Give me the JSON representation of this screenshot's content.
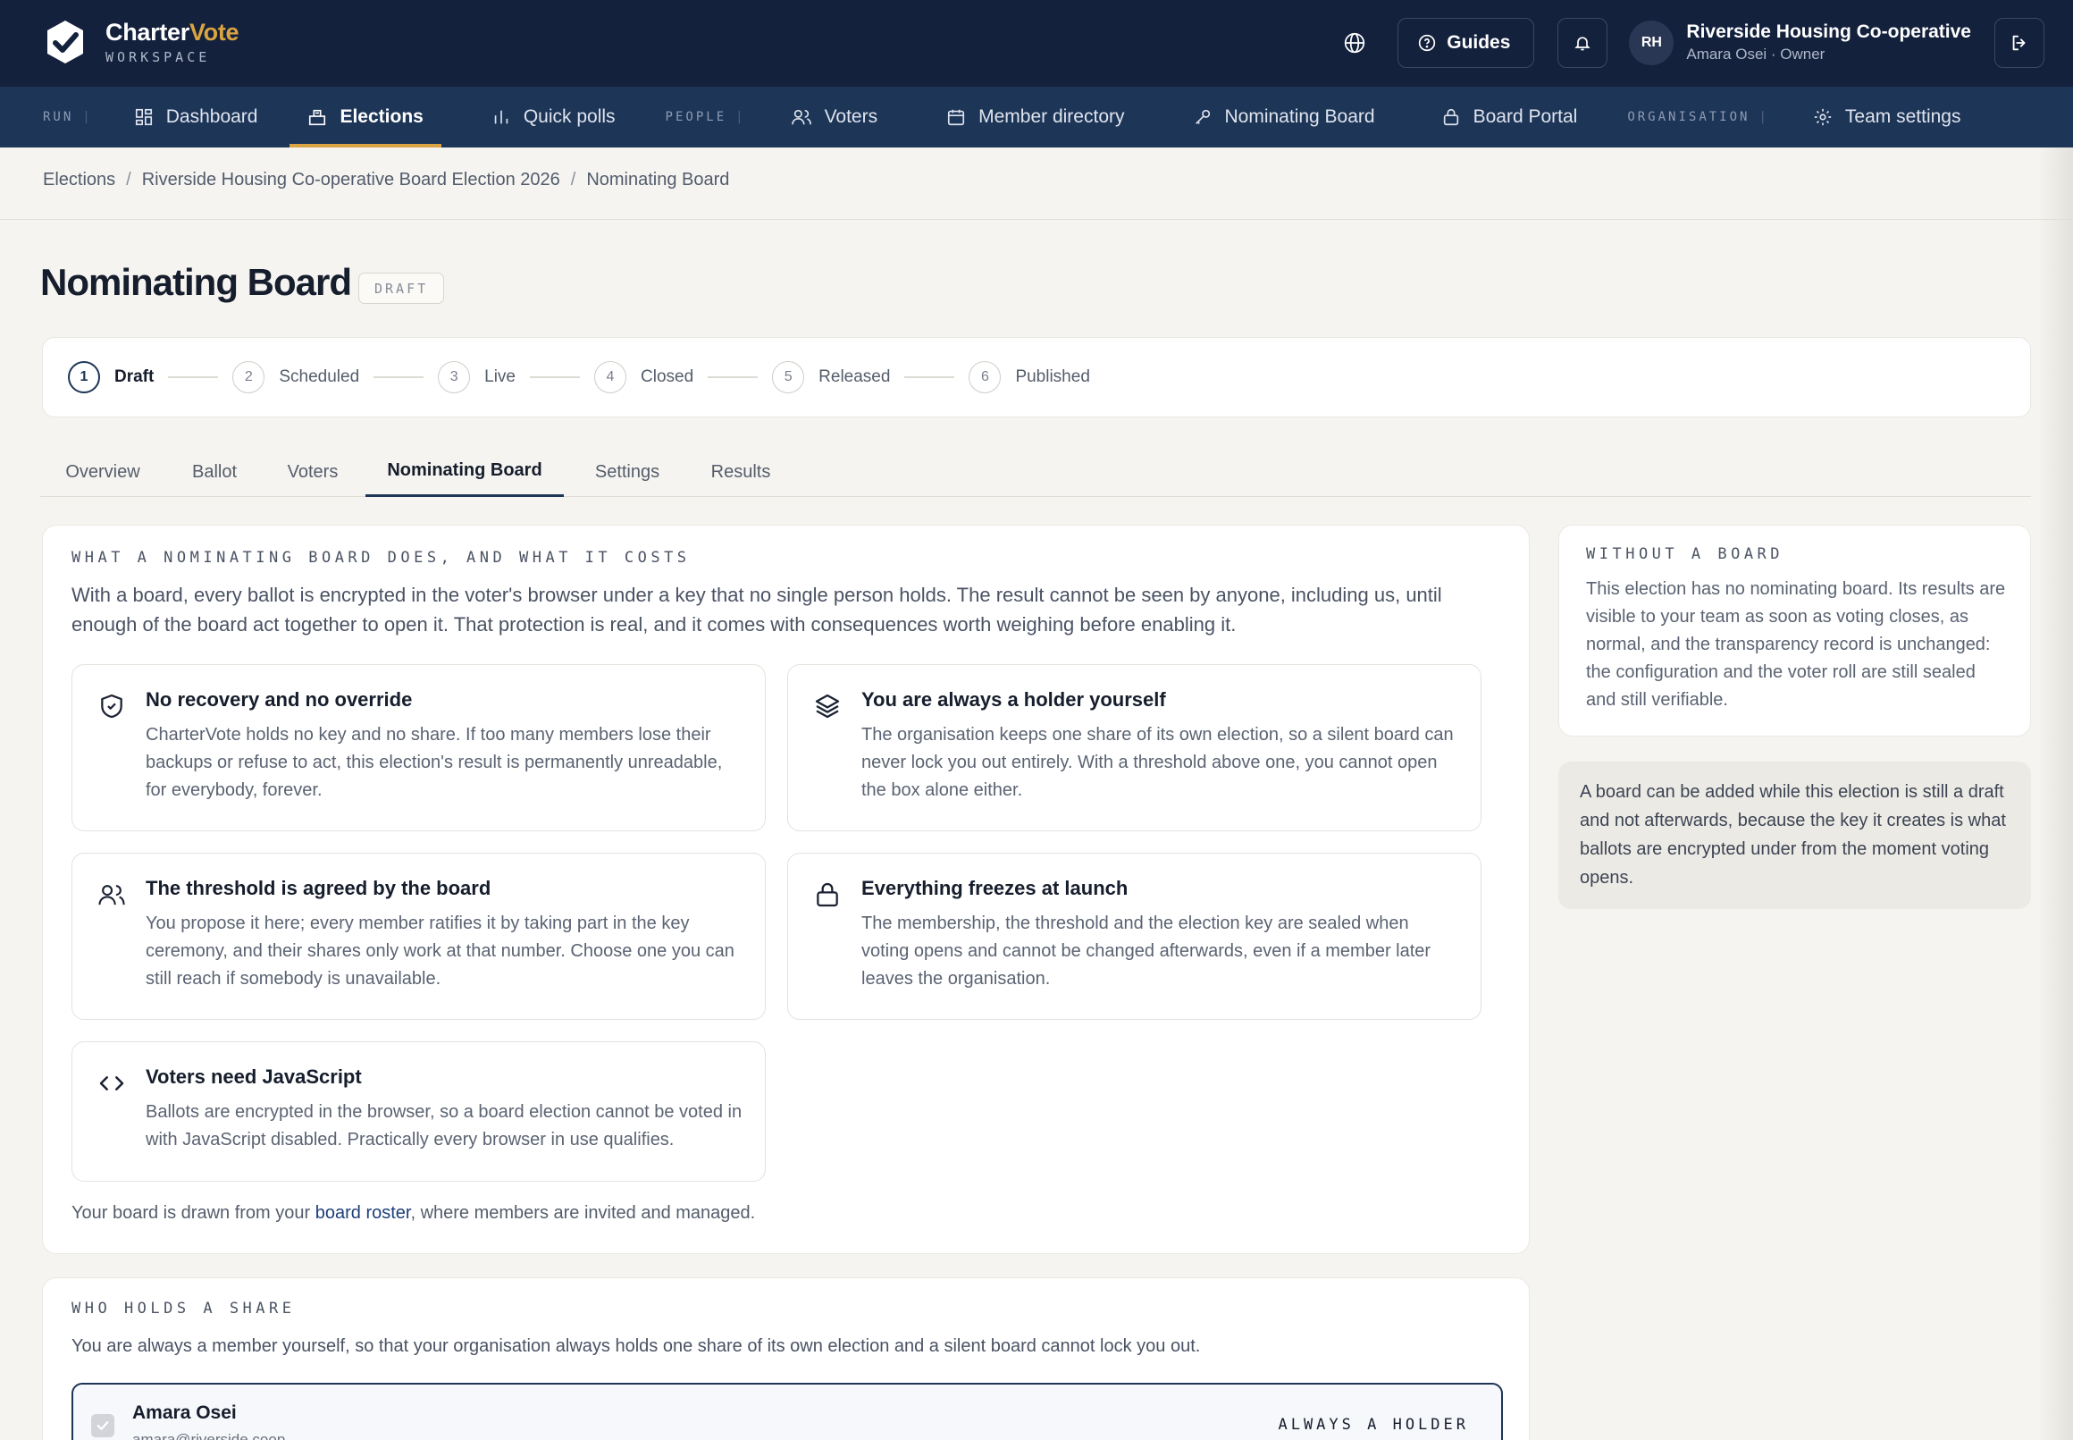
{
  "brand": {
    "name_main": "Charter",
    "name_accent": "Vote",
    "subtitle": "WORKSPACE"
  },
  "header": {
    "guides_label": "Guides",
    "avatar_initials": "RH",
    "org_name": "Riverside Housing Co-operative",
    "user_line": "Amara Osei · Owner"
  },
  "nav": {
    "section_run": "RUN",
    "section_people": "PEOPLE",
    "section_org": "ORGANISATION",
    "dashboard": "Dashboard",
    "elections": "Elections",
    "quick_polls": "Quick polls",
    "voters": "Voters",
    "member_directory": "Member directory",
    "nominating_board": "Nominating Board",
    "board_portal": "Board Portal",
    "team_settings": "Team settings"
  },
  "breadcrumb": {
    "root": "Elections",
    "election": "Riverside Housing Co-operative Board Election 2026",
    "current": "Nominating Board"
  },
  "page": {
    "title": "Nominating Board",
    "status": "DRAFT"
  },
  "stepper": [
    {
      "num": "1",
      "label": "Draft"
    },
    {
      "num": "2",
      "label": "Scheduled"
    },
    {
      "num": "3",
      "label": "Live"
    },
    {
      "num": "4",
      "label": "Closed"
    },
    {
      "num": "5",
      "label": "Released"
    },
    {
      "num": "6",
      "label": "Published"
    }
  ],
  "tabs": [
    "Overview",
    "Ballot",
    "Voters",
    "Nominating Board",
    "Settings",
    "Results"
  ],
  "main": {
    "eyebrow": "WHAT A NOMINATING BOARD DOES, AND WHAT IT COSTS",
    "intro": "With a board, every ballot is encrypted in the voter's browser under a key that no single person holds. The result cannot be seen by anyone, including us, until enough of the board act together to open it. That protection is real, and it comes with consequences worth weighing before enabling it.",
    "features": [
      {
        "title": "No recovery and no override",
        "body": "CharterVote holds no key and no share. If too many members lose their backups or refuse to act, this election's result is permanently unreadable, for everybody, forever.",
        "icon": "shield-icon"
      },
      {
        "title": "You are always a holder yourself",
        "body": "The organisation keeps one share of its own election, so a silent board can never lock you out entirely. With a threshold above one, you cannot open the box alone either.",
        "icon": "layers-icon"
      },
      {
        "title": "The threshold is agreed by the board",
        "body": "You propose it here; every member ratifies it by taking part in the key ceremony, and their shares only work at that number. Choose one you can still reach if somebody is unavailable.",
        "icon": "users-icon"
      },
      {
        "title": "Everything freezes at launch",
        "body": "The membership, the threshold and the election key are sealed when voting opens and cannot be changed afterwards, even if a member later leaves the organisation.",
        "icon": "lock-icon"
      },
      {
        "title": "Voters need JavaScript",
        "body": "Ballots are encrypted in the browser, so a board election cannot be voted in with JavaScript disabled. Practically every browser in use qualifies.",
        "icon": "code-icon"
      }
    ],
    "footnote_before": "Your board is drawn from your ",
    "footnote_link": "board roster",
    "footnote_after": ", where members are invited and managed."
  },
  "side": {
    "eyebrow": "WITHOUT A BOARD",
    "body": "This election has no nominating board. Its results are visible to your team as soon as voting closes, as normal, and the transparency record is unchanged: the configuration and the voter roll are still sealed and still verifiable.",
    "note": "A board can be added while this election is still a draft and not afterwards, because the key it creates is what ballots are encrypted under from the moment voting opens."
  },
  "shares": {
    "eyebrow": "WHO HOLDS A SHARE",
    "description": "You are always a member yourself, so that your organisation always holds one share of its own election and a silent board cannot lock you out.",
    "holder_name": "Amara Osei",
    "holder_email": "amara@riverside.coop",
    "holder_tag": "ALWAYS A HOLDER"
  }
}
